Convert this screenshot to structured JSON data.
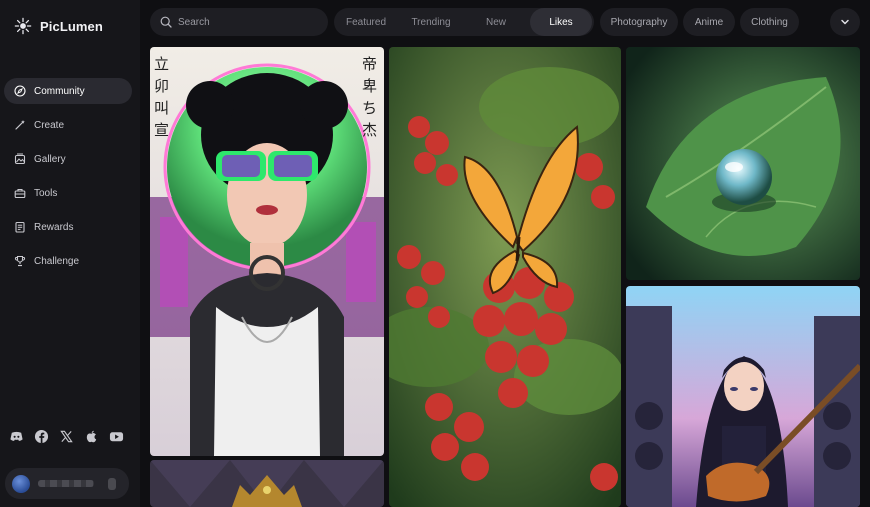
{
  "brand": {
    "name": "PicLumen"
  },
  "sidebar": {
    "items": [
      {
        "label": "Community",
        "icon": "compass-icon",
        "active": true
      },
      {
        "label": "Create",
        "icon": "wand-icon",
        "active": false
      },
      {
        "label": "Gallery",
        "icon": "gallery-icon",
        "active": false
      },
      {
        "label": "Tools",
        "icon": "toolbox-icon",
        "active": false
      },
      {
        "label": "Rewards",
        "icon": "rewards-icon",
        "active": false
      },
      {
        "label": "Challenge",
        "icon": "trophy-icon",
        "active": false
      }
    ],
    "socials": [
      "discord-icon",
      "facebook-icon",
      "x-icon",
      "apple-icon",
      "youtube-icon"
    ]
  },
  "search": {
    "placeholder": "Search",
    "value": ""
  },
  "tabs": [
    {
      "label": "Featured",
      "active": false
    },
    {
      "label": "Trending",
      "active": false
    },
    {
      "label": "New",
      "active": false
    },
    {
      "label": "Likes",
      "active": true
    }
  ],
  "chips": [
    {
      "label": "Photography"
    },
    {
      "label": "Anime"
    },
    {
      "label": "Clothing"
    }
  ],
  "gallery": {
    "cards": [
      {
        "subject": "Punk girl with neon sunglasses and tattoos"
      },
      {
        "subject": "Monarch butterfly on red berries"
      },
      {
        "subject": "Water droplet on green leaf"
      },
      {
        "subject": "Anime girl playing electric guitar"
      },
      {
        "subject": "Ornate crown artwork"
      }
    ]
  },
  "colors": {
    "background": "#0f0f12",
    "sidebar": "#16161a",
    "pill": "#1e1e23",
    "active_pill": "#2e2e35",
    "text": "#e6e6ea"
  }
}
